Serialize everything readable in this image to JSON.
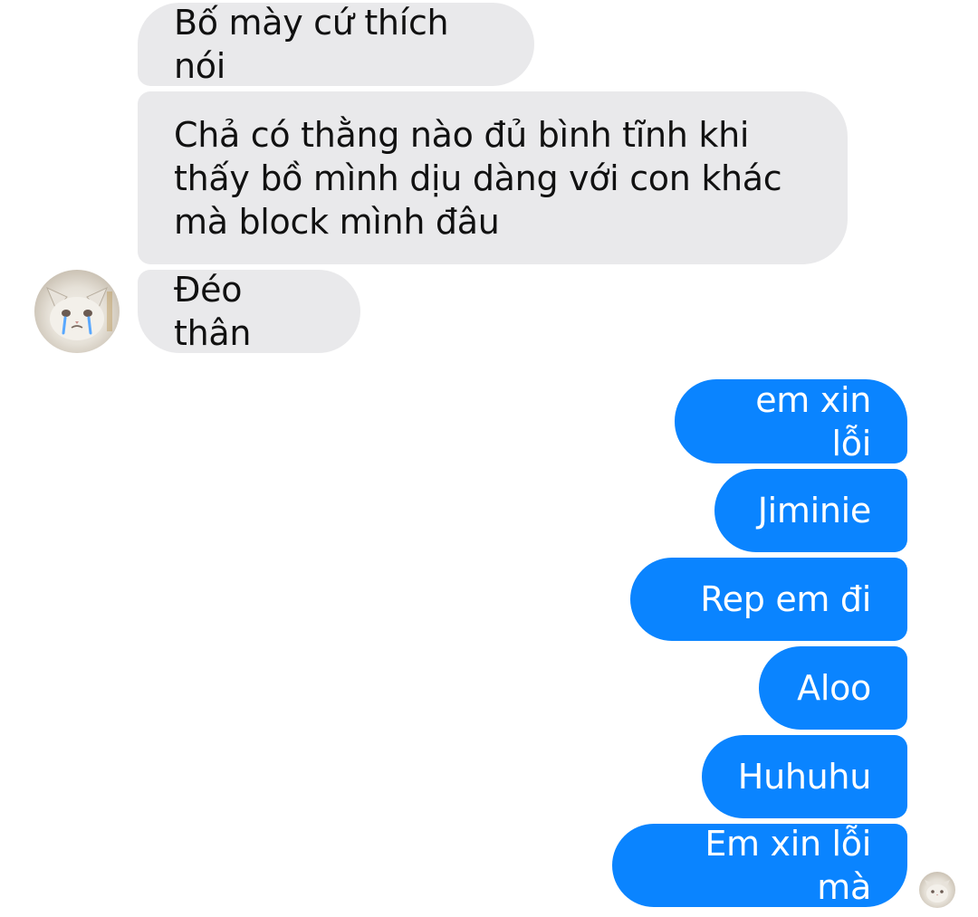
{
  "conversation": {
    "incoming": [
      {
        "text": "Bố mày cứ thích nói"
      },
      {
        "text": "Chả có thằng nào đủ bình tĩnh khi\nthấy bồ mình dịu dàng với con khác\nmà block mình đâu"
      },
      {
        "text": "Đéo thân"
      }
    ],
    "outgoing": [
      {
        "text": "em xin lỗi"
      },
      {
        "text": "Jiminie"
      },
      {
        "text": "Rep em đi"
      },
      {
        "text": "Aloo"
      },
      {
        "text": "Huhuhu"
      },
      {
        "text": "Em xin lỗi mà"
      }
    ]
  },
  "avatars": {
    "contact_icon": "crying-cat-avatar-icon",
    "read_receipt_icon": "cat-read-receipt-icon"
  },
  "colors": {
    "incoming_bubble": "#e9e9eb",
    "outgoing_bubble": "#0a84ff",
    "outgoing_text": "#ffffff",
    "incoming_text": "#111111"
  }
}
